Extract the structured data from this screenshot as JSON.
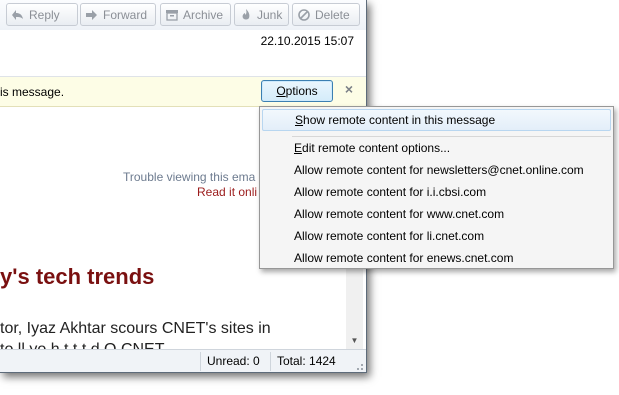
{
  "toolbar": {
    "reply": "Reply",
    "forward": "Forward",
    "archive": "Archive",
    "junk": "Junk",
    "delete": "Delete"
  },
  "header": {
    "date": "22.10.2015 15:07"
  },
  "notification": {
    "text": "is message.",
    "options_label_prefix": "",
    "options_label_underlined": "O",
    "options_label_rest": "ptions",
    "close": "×"
  },
  "body": {
    "trouble_text": "Trouble viewing this ema",
    "read_it_text": "Read it onli",
    "headline": "y's tech trends",
    "para_line1": "tor, Iyaz Akhtar scours CNET's sites in",
    "para_line2": "  to ll yo h   t t  t   d   O  CNET"
  },
  "status": {
    "unread": "Unread: 0",
    "total": "Total: 1424"
  },
  "menu": {
    "items": [
      {
        "ul": "S",
        "rest": "how remote content in this message"
      },
      {
        "ul": "E",
        "rest": "dit remote content options..."
      },
      {
        "ul": "",
        "rest": "Allow remote content for newsletters@cnet.online.com"
      },
      {
        "ul": "",
        "rest": "Allow remote content for i.i.cbsi.com"
      },
      {
        "ul": "",
        "rest": "Allow remote content for www.cnet.com"
      },
      {
        "ul": "",
        "rest": "Allow remote content for li.cnet.com"
      },
      {
        "ul": "",
        "rest": "Allow remote content for enews.cnet.com"
      }
    ]
  },
  "colors": {
    "headline": "#7a1010",
    "link_red": "#9b1b1b",
    "muted_blue": "#6d7b8f"
  }
}
